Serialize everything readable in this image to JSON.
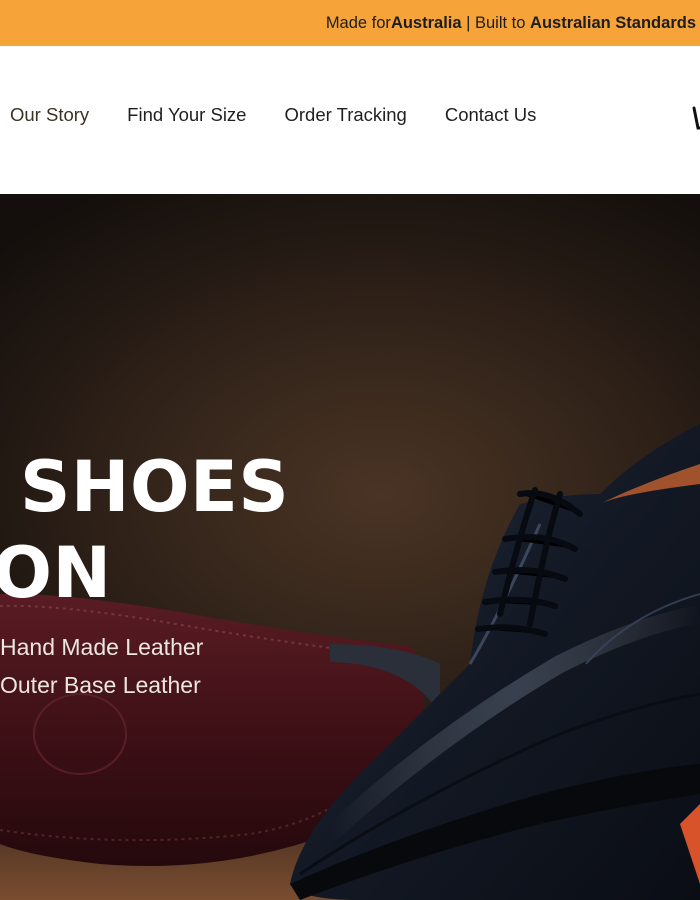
{
  "announcement": {
    "prefix": "Made for ",
    "country": "Australia",
    "divider": " | Built to ",
    "standard": "Australian Standards"
  },
  "nav": {
    "items": [
      {
        "label": "Our Story"
      },
      {
        "label": "Find Your Size"
      },
      {
        "label": "Order Tracking"
      },
      {
        "label": "Contact Us"
      }
    ],
    "cart_icon": "cart-icon"
  },
  "hero": {
    "heading_line1": "SHOES",
    "heading_line2": "ION",
    "features": [
      "Hand Made Leather",
      "Outer Base Leather"
    ]
  },
  "colors": {
    "announcement_bg": "#f6a43a",
    "hero_bg": "#2a1e16",
    "shoe_leather": "#1b2230"
  }
}
